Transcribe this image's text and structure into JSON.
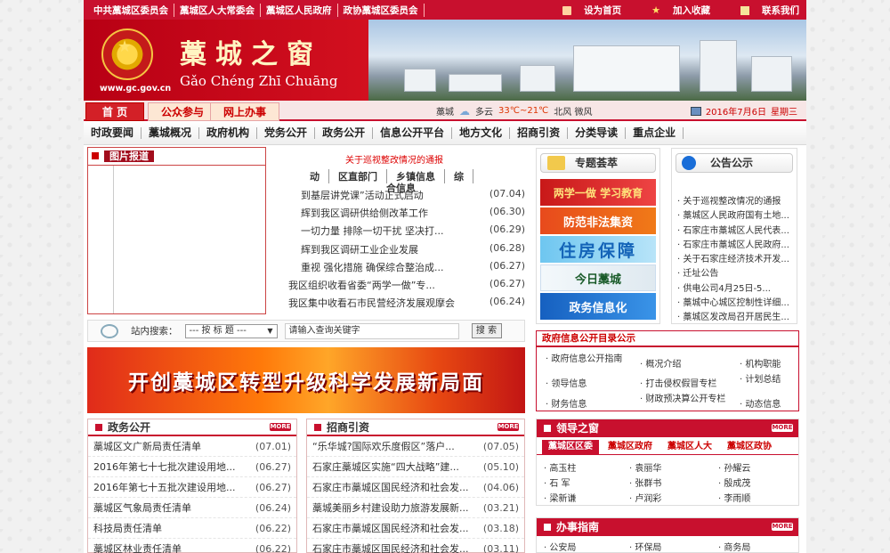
{
  "toplinks": {
    "left": [
      "中共藁城区委员会",
      "藁城区人大常委会",
      "藁城区人民政府",
      "政协藁城区委员会"
    ],
    "right": [
      "设为首页",
      "加入收藏",
      "联系我们"
    ]
  },
  "banner": {
    "url": "www.gc.gov.cn",
    "title": "藁城之窗",
    "pinyin": "Gǎo Chéng Zhī Chuāng"
  },
  "main_tabs": [
    "首 页",
    "公众参与",
    "网上办事"
  ],
  "weather": {
    "city": "藁城",
    "condition": "多云",
    "temp": "33℃~21℃",
    "wind": "北风  微风"
  },
  "date": {
    "date": "2016年7月6日",
    "weekday": "星期三"
  },
  "nav": [
    "时政要闻",
    "藁城概况",
    "政府机构",
    "党务公开",
    "政务公开",
    "信息公开平台",
    "地方文化",
    "招商引资",
    "分类导读",
    "重点企业"
  ],
  "photo_news": {
    "title": "图片报道"
  },
  "news": {
    "headline": "关于巡视整改情况的通报",
    "tabs": [
      "动",
      "区直部门",
      "乡镇信息",
      "综"
    ],
    "sub_tab": "合信息",
    "items": [
      {
        "t": "到基层讲党课”活动正式启动",
        "d": "(07.04)"
      },
      {
        "t": "辉到我区调研供给侧改革工作",
        "d": "(06.30)"
      },
      {
        "t": "一切力量 排除一切干扰 坚决打...",
        "d": "(06.29)"
      },
      {
        "t": "辉到我区调研工业企业发展",
        "d": "(06.28)"
      },
      {
        "t": "重视 强化措施 确保综合整治成...",
        "d": "(06.27)"
      },
      {
        "t": "我区组织收看省委“两学一做”专...",
        "d": "(06.27)"
      },
      {
        "t": "我区集中收看石市民营经济发展观摩会",
        "d": "(06.24)"
      }
    ]
  },
  "search": {
    "label": "站内搜索：",
    "select": "--- 按 标 题 ---",
    "placeholder": "请输入查询关键字",
    "button": "搜 索"
  },
  "slogan": "开创藁城区转型升级科学发展新局面",
  "zwgk": {
    "title": "政务公开",
    "more": "MORE",
    "items": [
      {
        "t": "藁城区文广新局责任清单",
        "d": "(07.01)"
      },
      {
        "t": "2016年第七十七批次建设用地...",
        "d": "(06.27)"
      },
      {
        "t": "2016年第七十五批次建设用地...",
        "d": "(06.27)"
      },
      {
        "t": "藁城区气象局责任清单",
        "d": "(06.24)"
      },
      {
        "t": "科技局责任清单",
        "d": "(06.22)"
      },
      {
        "t": "藁城区林业责任清单",
        "d": "(06.22)"
      }
    ]
  },
  "zsyz": {
    "title": "招商引资",
    "more": "MORE",
    "items": [
      {
        "t": "“乐华城?国际欢乐度假区”落户...",
        "d": "(07.05)"
      },
      {
        "t": "石家庄藁城区实施“四大战略”建...",
        "d": "(05.10)"
      },
      {
        "t": "石家庄市藁城区国民经济和社会发...",
        "d": "(04.06)"
      },
      {
        "t": "藁城美丽乡村建设助力旅游发展新...",
        "d": "(03.21)"
      },
      {
        "t": "石家庄市藁城区国民经济和社会发...",
        "d": "(03.18)"
      },
      {
        "t": "石家庄市藁城区国民经济和社会发...",
        "d": "(03.11)"
      }
    ]
  },
  "special": {
    "title": "专题荟萃",
    "banners": [
      "两学一做 学习教育",
      "防范非法集资",
      "住房保障",
      "今日藁城",
      "政务信息化"
    ]
  },
  "notice": {
    "title": "公告公示",
    "items": [
      "关于巡视整改情况的通报",
      "藁城区人民政府国有土地...",
      "石家庄市藁城区人民代表...",
      "石家庄市藁城区人民政府...",
      "关于石家庄经济技术开发...",
      "迁址公告",
      "供电公司4月25日-5...",
      "藁城中心城区控制性详细...",
      "藁城区发改局召开居民生..."
    ]
  },
  "info": {
    "title": "政府信息公开目录公示",
    "cells": [
      "政府信息公开指南",
      "概况介绍",
      "机构职能",
      "计划总结",
      "领导信息",
      "打击侵权假冒专栏",
      "财务信息",
      "财政预决算公开专栏",
      "动态信息"
    ]
  },
  "leaders": {
    "title": "领导之窗",
    "more": "MORE",
    "tabs": [
      "藁城区区委",
      "藁城区政府",
      "藁城区人大",
      "藁城区政协"
    ],
    "names": [
      "高玉柱",
      "袁丽华",
      "孙耀云",
      "石  军",
      "张群书",
      "殷成茂",
      "梁新谦",
      "卢润彩",
      "李雨顺"
    ]
  },
  "guide": {
    "title": "办事指南",
    "more": "MORE",
    "items": [
      "公安局",
      "环保局",
      "商务局"
    ]
  }
}
